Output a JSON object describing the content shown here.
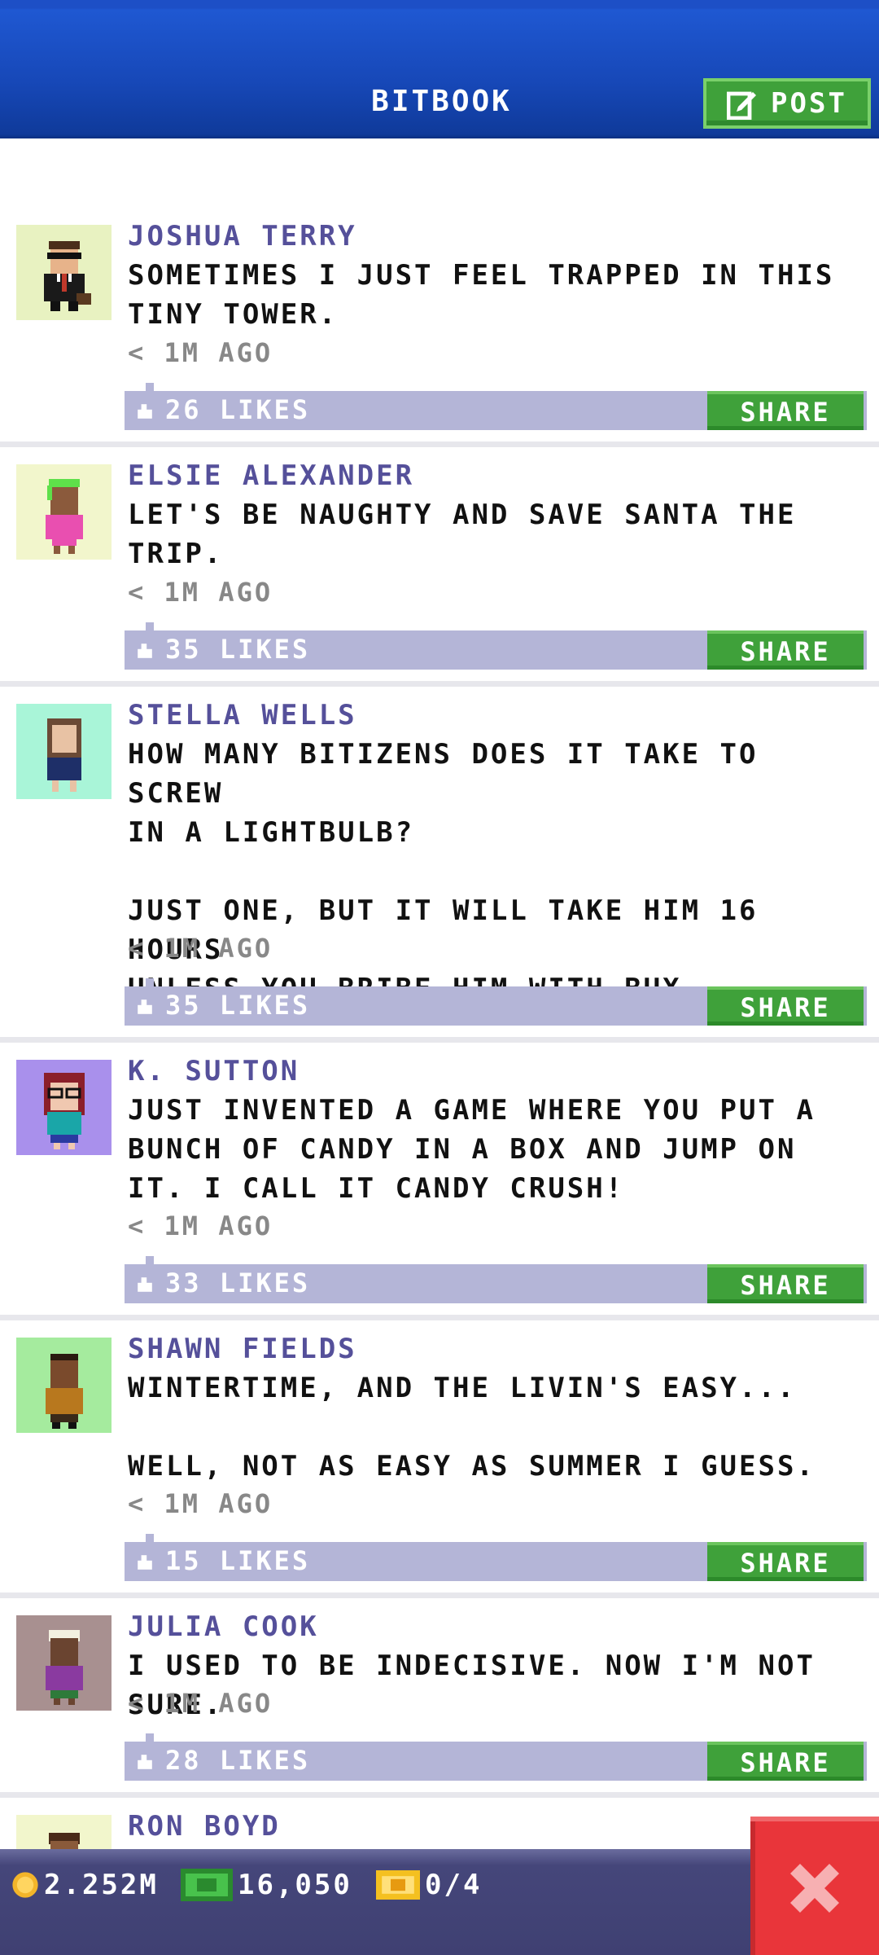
{
  "header": {
    "title": "BITBOOK",
    "post_label": "POST"
  },
  "posts": [
    {
      "name": "JOSHUA TERRY",
      "message": "SOMETIMES I JUST FEEL TRAPPED IN THIS\nTINY TOWER.",
      "time": "< 1M AGO",
      "likes": "26 LIKES",
      "share": "SHARE",
      "avatar_bg": "#e8f2c1"
    },
    {
      "name": "ELSIE ALEXANDER",
      "message": "LET'S BE NAUGHTY AND SAVE SANTA THE\nTRIP.",
      "time": "< 1M AGO",
      "likes": "35 LIKES",
      "share": "SHARE",
      "avatar_bg": "#f2f6cc"
    },
    {
      "name": "STELLA WELLS",
      "message": "HOW MANY BITIZENS DOES IT TAKE TO SCREW\nIN A LIGHTBULB?\n\nJUST ONE, BUT IT WILL TAKE HIM 16 HOURS\nUNLESS YOU BRIBE HIM WITH BUX.",
      "time": "< 1M AGO",
      "likes": "35 LIKES",
      "share": "SHARE",
      "avatar_bg": "#a9f5d8"
    },
    {
      "name": "K. SUTTON",
      "message": "JUST INVENTED A GAME WHERE YOU PUT A\nBUNCH OF CANDY IN A BOX AND JUMP ON\nIT. I CALL IT CANDY CRUSH!",
      "time": "< 1M AGO",
      "likes": "33 LIKES",
      "share": "SHARE",
      "avatar_bg": "#a990ec"
    },
    {
      "name": "SHAWN FIELDS",
      "message": "WINTERTIME, AND THE LIVIN'S EASY...\n\nWELL, NOT AS EASY AS SUMMER I GUESS.",
      "time": "< 1M AGO",
      "likes": "15 LIKES",
      "share": "SHARE",
      "avatar_bg": "#a5eb9e"
    },
    {
      "name": "JULIA COOK",
      "message": "I USED TO BE INDECISIVE. NOW I'M NOT SURE.",
      "time": "< 1M AGO",
      "likes": "28 LIKES",
      "share": "SHARE",
      "avatar_bg": "#a89090"
    },
    {
      "name": "RON BOYD",
      "message": "",
      "time": "",
      "likes": "",
      "share": "",
      "avatar_bg": "#f2f6cc"
    }
  ],
  "footer": {
    "coins": "2.252M",
    "bux": "16,050",
    "tickets": "0/4"
  },
  "colors": {
    "header_blue": "#1748b8",
    "green": "#3fa13a",
    "likes_bar": "#b4b5d7",
    "name": "#55509a",
    "close_red": "#e9353a"
  },
  "icons": {
    "post": "edit-icon",
    "thumb": "thumb-up-icon",
    "coin": "coin-icon",
    "bux": "bux-icon",
    "ticket": "ticket-icon",
    "close": "close-icon"
  }
}
